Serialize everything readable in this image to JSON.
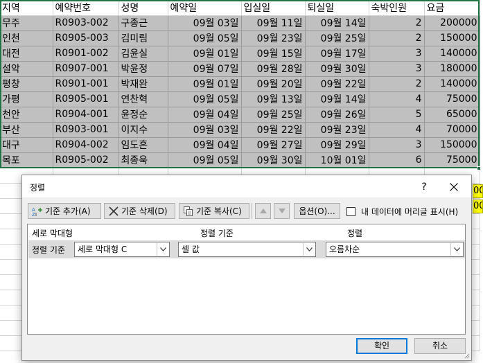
{
  "sheet": {
    "headers": [
      "지역",
      "예약번호",
      "성명",
      "예약일",
      "입실일",
      "퇴실일",
      "숙박인원",
      "요금"
    ],
    "rows": [
      [
        "무주",
        "R0903-002",
        "구종근",
        "09월 03일",
        "09월 11일",
        "09월 14일",
        "2",
        "200000"
      ],
      [
        "인천",
        "R0905-003",
        "김미림",
        "09월 05일",
        "09월 23일",
        "09월 25일",
        "2",
        "150000"
      ],
      [
        "대전",
        "R0901-002",
        "김윤실",
        "09월 01일",
        "09월 15일",
        "09월 17일",
        "3",
        "140000"
      ],
      [
        "설악",
        "R0907-001",
        "박윤정",
        "09월 07일",
        "09월 28일",
        "09월 30일",
        "3",
        "180000"
      ],
      [
        "평창",
        "R0901-001",
        "박재완",
        "09월 01일",
        "09월 20일",
        "09월 22일",
        "2",
        "140000"
      ],
      [
        "가평",
        "R0905-001",
        "연찬혁",
        "09월 05일",
        "09월 13일",
        "09월 14일",
        "4",
        "75000"
      ],
      [
        "천안",
        "R0904-001",
        "윤정순",
        "09월 04일",
        "09월 25일",
        "09월 26일",
        "5",
        "65000"
      ],
      [
        "부산",
        "R0903-001",
        "이지수",
        "09월 03일",
        "09월 22일",
        "09월 23일",
        "4",
        "70000"
      ],
      [
        "대구",
        "R0904-002",
        "임도흔",
        "09월 04일",
        "09월 27일",
        "09월 29일",
        "3",
        "150000"
      ],
      [
        "목포",
        "R0905-002",
        "최종욱",
        "09월 05일",
        "09월 30일",
        "10월 01일",
        "6",
        "75000"
      ]
    ],
    "yellow_cells": [
      "00",
      "00"
    ],
    "colors": {
      "selection": "#217346",
      "highlight": "#ffff00",
      "selected_fill": "#c0c0c0"
    }
  },
  "dialog": {
    "title": "정렬",
    "help": "?",
    "toolbar": {
      "add_level": "기준 추가(A)",
      "delete_level": "기준 삭제(D)",
      "copy_level": "기준 복사(C)",
      "options": "옵션(O)...",
      "header_checkbox_label": "내 데이터에 머리글 표시(H)",
      "header_checkbox_checked": false
    },
    "columns": {
      "column": "세로 막대형",
      "sort_on": "정렬 기준",
      "order": "정렬"
    },
    "level": {
      "label": "정렬 기준",
      "column_value": "세로 막대형 C",
      "sort_on_value": "셀 값",
      "order_value": "오름차순"
    },
    "ok": "확인",
    "cancel": "취소"
  }
}
